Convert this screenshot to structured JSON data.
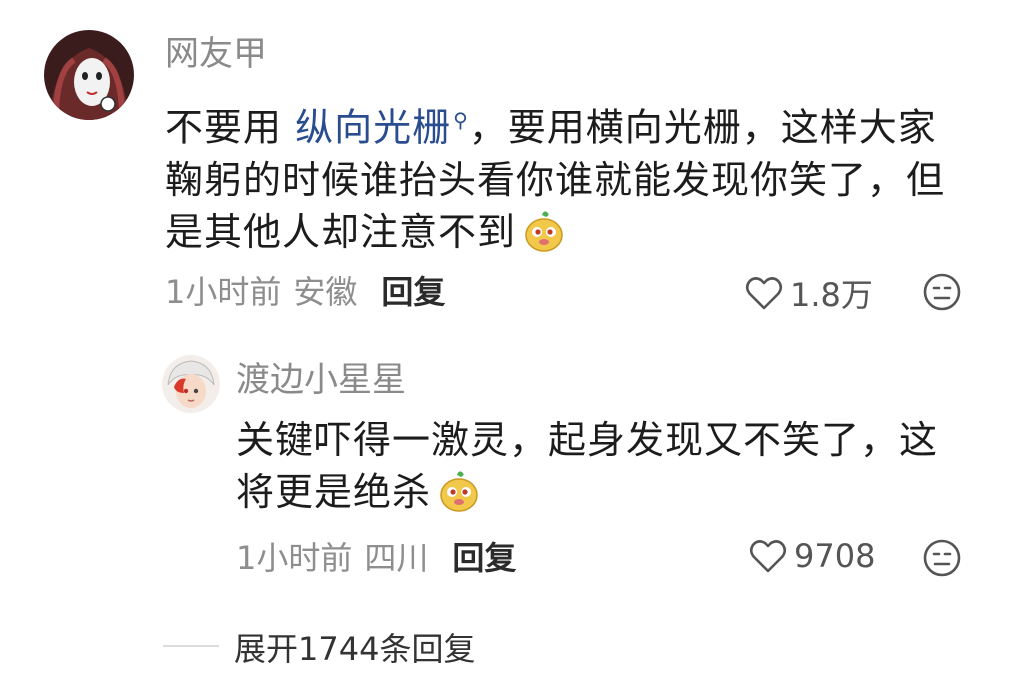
{
  "comment": {
    "username": "网友甲",
    "text_before_link": "不要用 ",
    "link_term": "纵向光栅",
    "text_line1_rest": "，要用横向光栅，这样大家",
    "text_line2": "鞠躬的时候谁抬头看你谁就能发现你笑了，但",
    "text_line3": "是其他人却注意不到",
    "time": "1小时前",
    "location": "安徽",
    "reply_label": "回复",
    "likes": "1.8万",
    "emoji_icon": "cute-face-emoji"
  },
  "reply": {
    "username": "渡边小星星",
    "text_line1": "关键吓得一激灵，起身发现又不笑了，这",
    "text_line2": "将更是绝杀",
    "time": "1小时前",
    "location": "四川",
    "reply_label": "回复",
    "likes": "9708",
    "emoji_icon": "cute-face-emoji"
  },
  "expand": {
    "label": "展开1744条回复"
  }
}
